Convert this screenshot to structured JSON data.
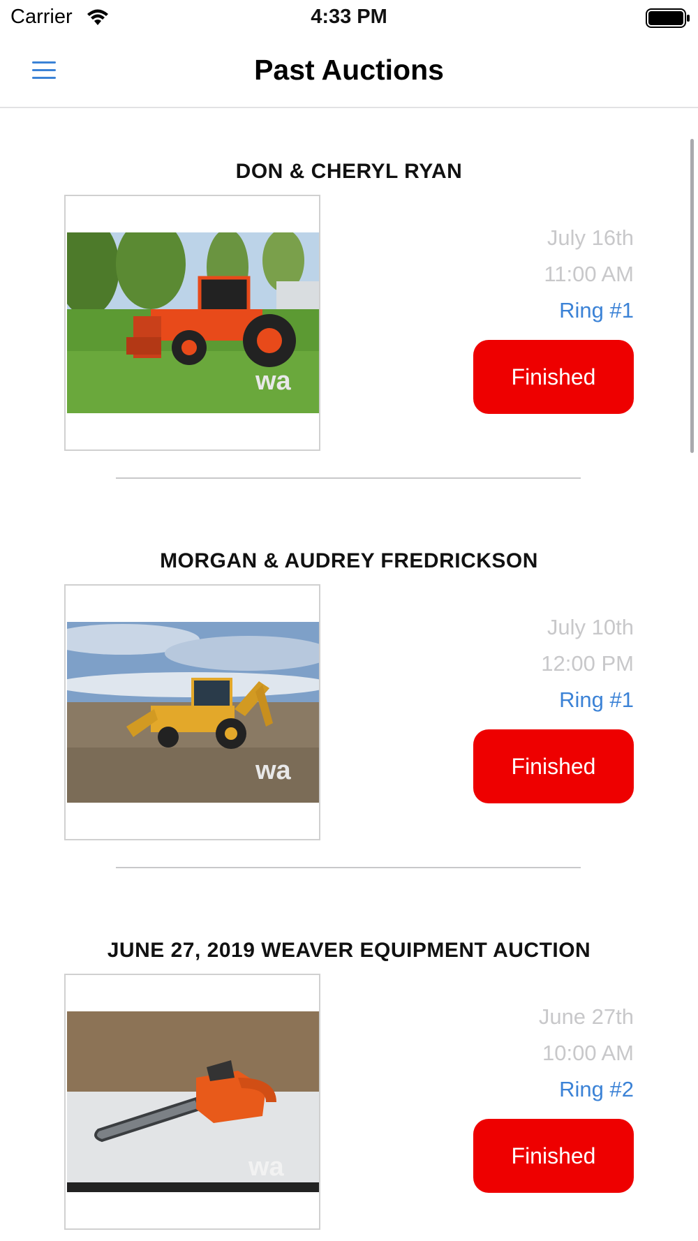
{
  "status_bar": {
    "carrier": "Carrier",
    "time": "4:33 PM"
  },
  "nav": {
    "title": "Past Auctions",
    "menu_icon": "hamburger-menu-icon",
    "accent_color": "#3b82d6"
  },
  "auctions": [
    {
      "title": "DON & CHERYL RYAN",
      "date": "July 16th",
      "time": "11:00 AM",
      "ring": "Ring #1",
      "status": "Finished",
      "image_watermark": "wa"
    },
    {
      "title": "MORGAN & AUDREY FREDRICKSON",
      "date": "July 10th",
      "time": "12:00 PM",
      "ring": "Ring #1",
      "status": "Finished",
      "image_watermark": "wa"
    },
    {
      "title": "JUNE 27, 2019 WEAVER EQUIPMENT AUCTION",
      "date": "June 27th",
      "time": "10:00 AM",
      "ring": "Ring #2",
      "status": "Finished",
      "image_watermark": "wa"
    }
  ],
  "colors": {
    "finished_button": "#ee0000",
    "ring_text": "#3b82d6",
    "muted_text": "#c8c8ca"
  }
}
